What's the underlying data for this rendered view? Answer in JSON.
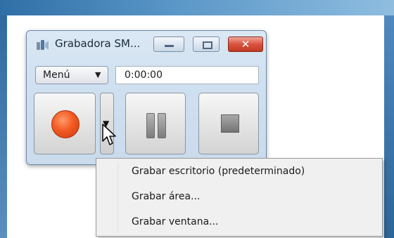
{
  "window": {
    "title": "Grabadora SM...",
    "icon": "sound-recorder-icon",
    "controls": [
      "minimize-icon",
      "maximize-icon",
      "close-icon"
    ],
    "close_glyph": "✕"
  },
  "toolbar": {
    "menu_label": "Menú",
    "menu_caret": "▼",
    "time": "0:00:00"
  },
  "buttons": {
    "record": "record-icon",
    "record_options_arrow": "▼",
    "pause": "pause-icon",
    "stop": "stop-icon"
  },
  "dropdown": {
    "items": [
      "Grabar escritorio (predeterminado)",
      "Grabar área...",
      "Grabar ventana..."
    ]
  },
  "colors": {
    "record_red": "#f25a22",
    "close_red": "#d9533f",
    "window_frame": "#cfe0f0",
    "menu_bg": "#f0f0f0"
  }
}
